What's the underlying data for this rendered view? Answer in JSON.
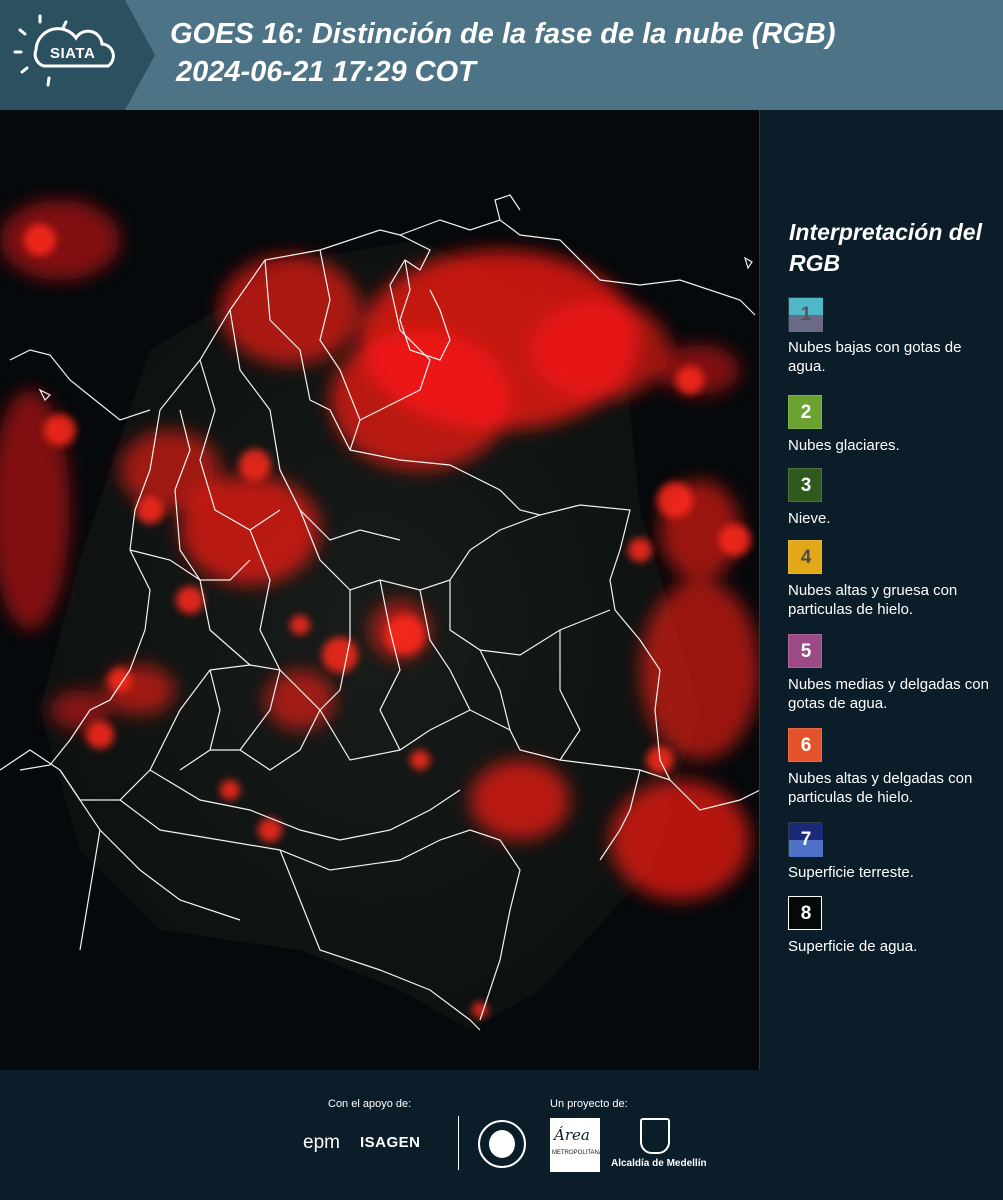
{
  "header": {
    "logo_text": "SIATA",
    "title": "GOES 16: Distinción de la fase de la nube (RGB)",
    "subtitle": "2024-06-21 17:29 COT"
  },
  "legend": {
    "title": "Interpretación del RGB",
    "items": [
      {
        "num": "1",
        "label": "Nubes bajas con gotas de agua.",
        "top_color": "#4fb8c8",
        "bottom_color": "#6b6a86",
        "num_color": "#555555"
      },
      {
        "num": "2",
        "label": "Nubes glaciares.",
        "top_color": "#6ca330",
        "bottom_color": "#6ca330",
        "num_color": "#ffffff"
      },
      {
        "num": "3",
        "label": "Nieve.",
        "top_color": "#2f5a1c",
        "bottom_color": "#2f5a1c",
        "num_color": "#ffffff"
      },
      {
        "num": "4",
        "label": "Nubes altas y gruesa con particulas de hielo.",
        "top_color": "#e2a818",
        "bottom_color": "#e2a818",
        "num_color": "#4a4a4a"
      },
      {
        "num": "5",
        "label": "Nubes medias y delgadas con gotas de agua.",
        "top_color": "#9b4a86",
        "bottom_color": "#9b4a86",
        "num_color": "#ffffff"
      },
      {
        "num": "6",
        "label": "Nubes altas y delgadas con particulas de hielo.",
        "top_color": "#e4532b",
        "bottom_color": "#e4532b",
        "num_color": "#ffffff"
      },
      {
        "num": "7",
        "label": "Superficie terreste.",
        "top_color": "#1b2a78",
        "bottom_color": "#4d72c8",
        "num_color": "#ffffff"
      },
      {
        "num": "8",
        "label": "Superficie de agua.",
        "top_color": "#050a08",
        "bottom_color": "#050a08",
        "num_color": "#ffffff"
      }
    ]
  },
  "footer": {
    "support_label": "Con el apoyo de:",
    "project_label": "Un proyecto de:",
    "epm": "epm",
    "isagen": "ISAGEN",
    "area_logo_text": "Área",
    "area_sub": "METROPOLITANA",
    "medellin": "Alcaldía de Medellín"
  },
  "map": {
    "cloud_color": "#ff1a14",
    "border_color": "#ffffff",
    "background_color": "#05090c"
  }
}
